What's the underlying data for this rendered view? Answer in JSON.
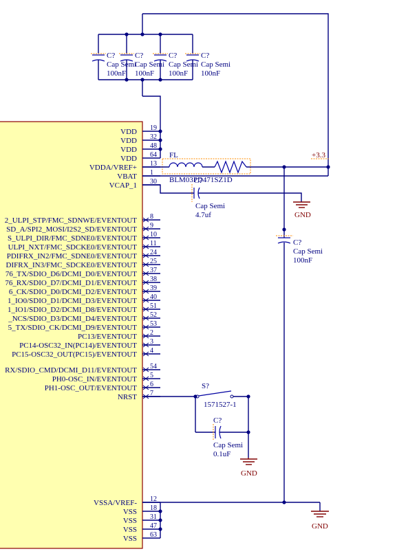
{
  "mcu": {
    "power_pins": [
      {
        "name": "VDD",
        "num": "19"
      },
      {
        "name": "VDD",
        "num": "32"
      },
      {
        "name": "VDD",
        "num": "48"
      },
      {
        "name": "VDD",
        "num": "64"
      },
      {
        "name": "VDDA/VREF+",
        "num": "13"
      },
      {
        "name": "VBAT",
        "num": "1"
      },
      {
        "name": "VCAP_1",
        "num": "30"
      }
    ],
    "io_pins": [
      {
        "name": "2_ULPI_STP/FMC_SDNWE/EVENTOUT",
        "num": "8"
      },
      {
        "name": "SD_A/SPI2_MOSI/I2S2_SD/EVENTOUT",
        "num": "9"
      },
      {
        "name": "S_ULPI_DIR/FMC_SDNE0/EVENTOUT",
        "num": "10"
      },
      {
        "name": "ULPI_NXT/FMC_SDCKE0/EVENTOUT",
        "num": "11"
      },
      {
        "name": "PDIFRX_IN2/FMC_SDNE0/EVENTOUT",
        "num": "24"
      },
      {
        "name": "DIFRX_IN3/FMC_SDCKE0/EVENTOUT",
        "num": "25"
      },
      {
        "name": "76_TX/SDIO_D6/DCMI_D0/EVENTOUT",
        "num": "37"
      },
      {
        "name": "76_RX/SDIO_D7/DCMI_D1/EVENTOUT",
        "num": "38"
      },
      {
        "name": "6_CK/SDIO_D0/DCMI_D2/EVENTOUT",
        "num": "39"
      },
      {
        "name": "1_IO0/SDIO_D1/DCMI_D3/EVENTOUT",
        "num": "40"
      },
      {
        "name": "1_IO1/SDIO_D2/DCMI_D8/EVENTOUT",
        "num": "51"
      },
      {
        "name": "_NCS/SDIO_D3/DCMI_D4/EVENTOUT",
        "num": "52"
      },
      {
        "name": "5_TX/SDIO_CK/DCMI_D9/EVENTOUT",
        "num": "53"
      },
      {
        "name": "PC13/EVENTOUT",
        "num": "2"
      },
      {
        "name": "PC14-OSC32_IN(PC14)/EVENTOUT",
        "num": "3"
      },
      {
        "name": "PC15-OSC32_OUT(PC15)/EVENTOUT",
        "num": "4"
      }
    ],
    "ctrl_pins": [
      {
        "name": "RX/SDIO_CMD/DCMI_D11/EVENTOUT",
        "num": "54"
      },
      {
        "name": "PH0-OSC_IN/EVENTOUT",
        "num": "5"
      },
      {
        "name": "PH1-OSC_OUT/EVENTOUT",
        "num": "6"
      },
      {
        "name": "NRST",
        "num": "7"
      }
    ],
    "ground_pins": [
      {
        "name": "VSSA/VREF-",
        "num": "12"
      },
      {
        "name": "VSS",
        "num": "18"
      },
      {
        "name": "VSS",
        "num": "31"
      },
      {
        "name": "VSS",
        "num": "47"
      },
      {
        "name": "VSS",
        "num": "63"
      }
    ]
  },
  "decoupling_caps": [
    {
      "designator": "C?",
      "comment": "Cap Semi",
      "value": "100nF"
    },
    {
      "designator": "C?",
      "comment": "Cap Semi",
      "value": "100nF"
    },
    {
      "designator": "C?",
      "comment": "Cap Semi",
      "value": "100nF"
    },
    {
      "designator": "C?",
      "comment": "Cap Semi",
      "value": "100nF"
    }
  ],
  "ferrite": {
    "designator": "FL",
    "part": "BLM03PD471SZ1D"
  },
  "vcap_cap": {
    "designator": "C?",
    "comment": "Cap Semi",
    "value": "4.7uf"
  },
  "vdda_cap": {
    "designator": "C?",
    "comment": "Cap Semi",
    "value": "100nF"
  },
  "reset_switch": {
    "designator": "S?",
    "part": "1571527-1"
  },
  "reset_cap": {
    "designator": "C?",
    "comment": "Cap Semi",
    "value": "0.1uF"
  },
  "power_port": "+3.3",
  "ground_label": "GND",
  "colors": {
    "wire": "#000080",
    "mcu_fill": "#ffffb0",
    "mcu_border": "#8b0000",
    "gnd": "#800000",
    "highlight": "#ff8c00"
  }
}
